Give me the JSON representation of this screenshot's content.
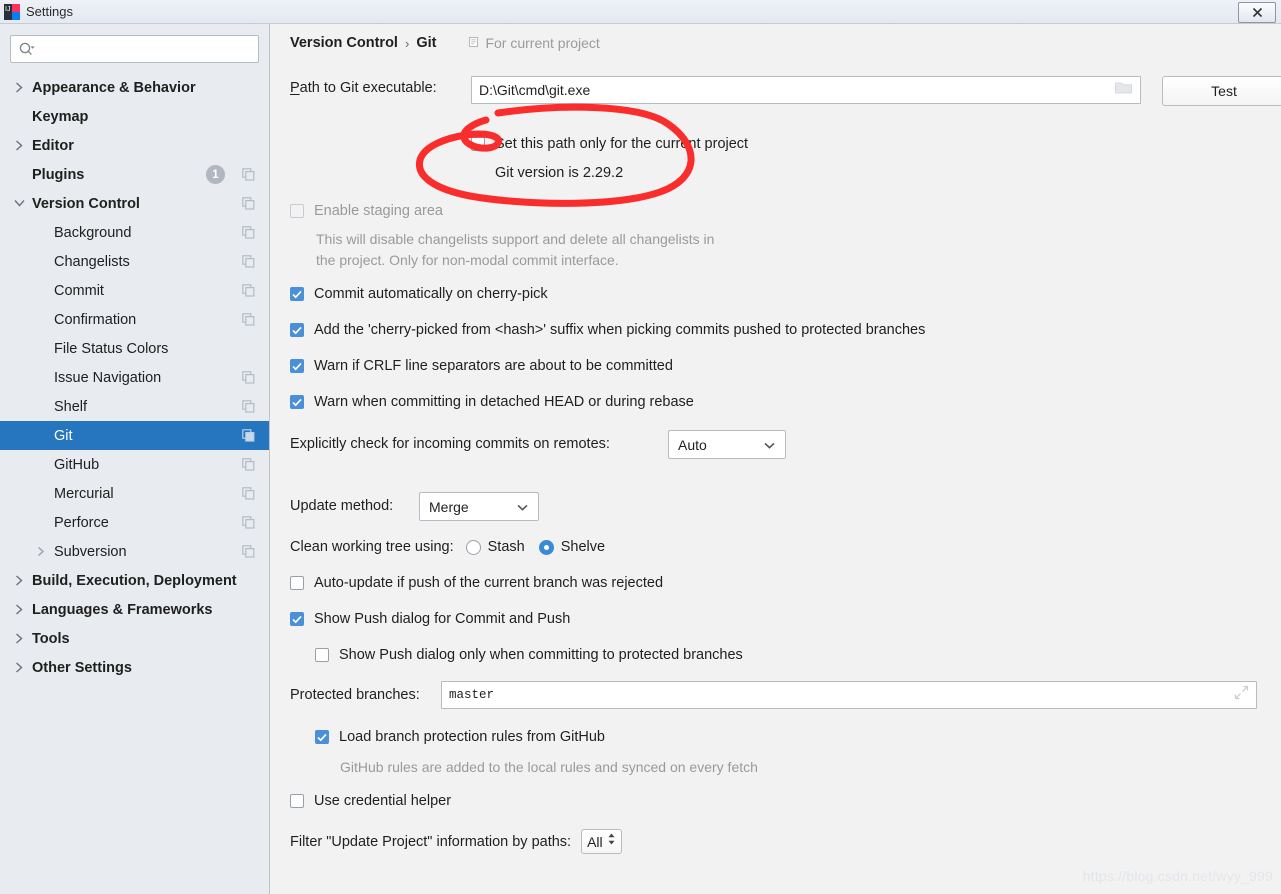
{
  "window": {
    "title": "Settings",
    "close_label": "Close",
    "app_icon": "intellij-idea-icon"
  },
  "search": {
    "value": "",
    "placeholder": "",
    "icon": "search-icon"
  },
  "sidebar": {
    "items": [
      {
        "label": "Appearance & Behavior",
        "level": 0,
        "bold": true,
        "arrow": "right",
        "badge": null,
        "copy": false,
        "selected": false
      },
      {
        "label": "Keymap",
        "level": 0,
        "bold": true,
        "arrow": "none",
        "badge": null,
        "copy": false,
        "selected": false
      },
      {
        "label": "Editor",
        "level": 0,
        "bold": true,
        "arrow": "right",
        "badge": null,
        "copy": false,
        "selected": false
      },
      {
        "label": "Plugins",
        "level": 0,
        "bold": true,
        "arrow": "none",
        "badge": "1",
        "copy": true,
        "selected": false
      },
      {
        "label": "Version Control",
        "level": 0,
        "bold": true,
        "arrow": "down",
        "badge": null,
        "copy": true,
        "selected": false
      },
      {
        "label": "Background",
        "level": 1,
        "bold": false,
        "arrow": "none",
        "badge": null,
        "copy": true,
        "selected": false
      },
      {
        "label": "Changelists",
        "level": 1,
        "bold": false,
        "arrow": "none",
        "badge": null,
        "copy": true,
        "selected": false
      },
      {
        "label": "Commit",
        "level": 1,
        "bold": false,
        "arrow": "none",
        "badge": null,
        "copy": true,
        "selected": false
      },
      {
        "label": "Confirmation",
        "level": 1,
        "bold": false,
        "arrow": "none",
        "badge": null,
        "copy": true,
        "selected": false
      },
      {
        "label": "File Status Colors",
        "level": 1,
        "bold": false,
        "arrow": "none",
        "badge": null,
        "copy": false,
        "selected": false
      },
      {
        "label": "Issue Navigation",
        "level": 1,
        "bold": false,
        "arrow": "none",
        "badge": null,
        "copy": true,
        "selected": false
      },
      {
        "label": "Shelf",
        "level": 1,
        "bold": false,
        "arrow": "none",
        "badge": null,
        "copy": true,
        "selected": false
      },
      {
        "label": "Git",
        "level": 1,
        "bold": false,
        "arrow": "none",
        "badge": null,
        "copy": true,
        "selected": true
      },
      {
        "label": "GitHub",
        "level": 1,
        "bold": false,
        "arrow": "none",
        "badge": null,
        "copy": true,
        "selected": false
      },
      {
        "label": "Mercurial",
        "level": 1,
        "bold": false,
        "arrow": "none",
        "badge": null,
        "copy": true,
        "selected": false
      },
      {
        "label": "Perforce",
        "level": 1,
        "bold": false,
        "arrow": "none",
        "badge": null,
        "copy": true,
        "selected": false
      },
      {
        "label": "Subversion",
        "level": 1,
        "bold": false,
        "arrow": "right-sm",
        "badge": null,
        "copy": true,
        "selected": false
      },
      {
        "label": "Build, Execution, Deployment",
        "level": 0,
        "bold": true,
        "arrow": "right",
        "badge": null,
        "copy": false,
        "selected": false
      },
      {
        "label": "Languages & Frameworks",
        "level": 0,
        "bold": true,
        "arrow": "right",
        "badge": null,
        "copy": false,
        "selected": false
      },
      {
        "label": "Tools",
        "level": 0,
        "bold": true,
        "arrow": "right",
        "badge": null,
        "copy": false,
        "selected": false
      },
      {
        "label": "Other Settings",
        "level": 0,
        "bold": true,
        "arrow": "right",
        "badge": null,
        "copy": false,
        "selected": false
      }
    ]
  },
  "main": {
    "breadcrumb": {
      "root": "Version Control",
      "separator": "›",
      "leaf": "Git",
      "scope_note": "For current project",
      "scope_icon": "project-scope-icon"
    },
    "git_path": {
      "label": "Path to Git executable:",
      "value": "D:\\Git\\cmd\\git.exe",
      "browse_icon": "folder-icon",
      "test_button": "Test"
    },
    "set_path_only_current_project": {
      "label": "Set this path only for the current project",
      "checked": false
    },
    "git_version_text": "Git version is 2.29.2",
    "enable_staging_area": {
      "label": "Enable staging area",
      "checked": false,
      "disabled": true,
      "help_line1": "This will disable changelists support and delete all changelists in",
      "help_line2": "the project. Only for non-modal commit interface."
    },
    "checkboxes": [
      {
        "label": "Commit automatically on cherry-pick",
        "checked": true
      },
      {
        "label": "Add the 'cherry-picked from <hash>' suffix when picking commits pushed to protected branches",
        "checked": true
      },
      {
        "label": "Warn if CRLF line separators are about to be committed",
        "checked": true
      },
      {
        "label": "Warn when committing in detached HEAD or during rebase",
        "checked": true
      }
    ],
    "incoming_commits": {
      "label": "Explicitly check for incoming commits on remotes:",
      "value": "Auto"
    },
    "update_method": {
      "label": "Update method:",
      "value": "Merge"
    },
    "clean_working_tree": {
      "label": "Clean working tree using:",
      "options": [
        {
          "label": "Stash",
          "selected": false
        },
        {
          "label": "Shelve",
          "selected": true
        }
      ]
    },
    "auto_update": {
      "label": "Auto-update if push of the current branch was rejected",
      "checked": false
    },
    "show_push_dialog": {
      "label": "Show Push dialog for Commit and Push",
      "checked": true
    },
    "show_push_dialog_protected": {
      "label": "Show Push dialog only when committing to protected branches",
      "checked": false
    },
    "protected_branches": {
      "label": "Protected branches:",
      "value": "master",
      "expand_icon": "expand-icon"
    },
    "load_branch_protection": {
      "label": "Load branch protection rules from GitHub",
      "checked": true,
      "help": "GitHub rules are added to the local rules and synced on every fetch"
    },
    "use_credential_helper": {
      "label": "Use credential helper",
      "checked": false
    },
    "filter_update_project": {
      "label": "Filter \"Update Project\" information by paths:",
      "value": "All"
    }
  },
  "annotation": {
    "color": "#fa2d2d",
    "shape": "hand-drawn-ellipse"
  },
  "watermark": "https://blog.csdn.net/wyy_999",
  "colors": {
    "accent": "#2675bf",
    "checkbox": "#4a90d9",
    "sidebar_bg": "#e8ebef",
    "panel_bg": "#f2f2f2",
    "annotation_red": "#fa2d2d"
  }
}
